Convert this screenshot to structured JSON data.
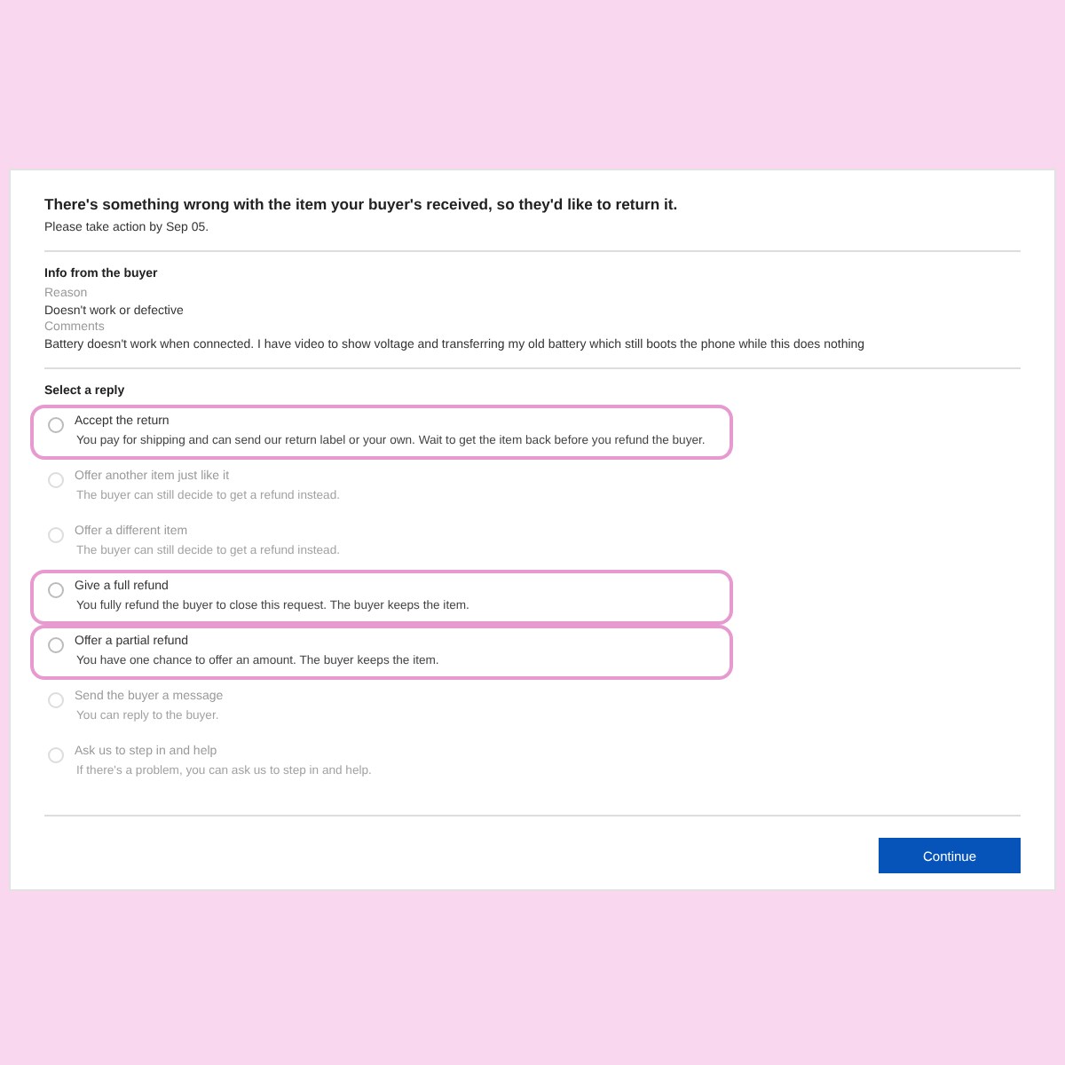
{
  "heading": "There's something wrong with the item your buyer's received, so they'd like to return it.",
  "deadline": "Please take action by Sep 05.",
  "buyer_info": {
    "title": "Info from the buyer",
    "fields": [
      {
        "label": "Reason",
        "value": "Doesn't work or defective"
      },
      {
        "label": "Comments",
        "value": "Battery doesn't work when connected. I have video to show voltage and transferring my old battery which still boots the phone while this does nothing"
      }
    ]
  },
  "reply": {
    "title": "Select a reply",
    "options": [
      {
        "label": "Accept the return",
        "description": "You pay for shipping and can send our return label or your own. Wait to get the item back before you refund the buyer.",
        "selected": false,
        "highlighted": true
      },
      {
        "label": "Offer another item just like it",
        "description": "The buyer can still decide to get a refund instead.",
        "selected": false,
        "highlighted": false
      },
      {
        "label": "Offer a different item",
        "description": "The buyer can still decide to get a refund instead.",
        "selected": false,
        "highlighted": false
      },
      {
        "label": "Give a full refund",
        "description": "You fully refund the buyer to close this request. The buyer keeps the item.",
        "selected": false,
        "highlighted": true
      },
      {
        "label": "Offer a partial refund",
        "description": "You have one chance to offer an amount. The buyer keeps the item.",
        "selected": false,
        "highlighted": true
      },
      {
        "label": "Send the buyer a message",
        "description": "You can reply to the buyer.",
        "selected": false,
        "highlighted": false
      },
      {
        "label": "Ask us to step in and help",
        "description": "If there's a problem, you can ask us to step in and help.",
        "selected": false,
        "highlighted": false
      }
    ]
  },
  "continue_button": "Continue"
}
